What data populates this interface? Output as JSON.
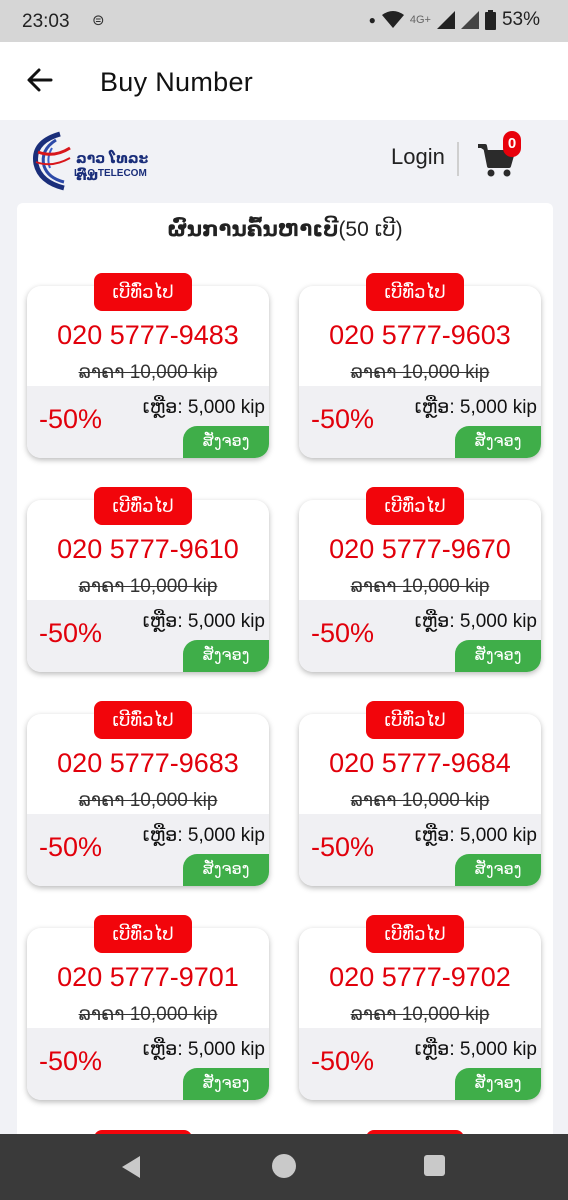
{
  "status_bar": {
    "time": "23:03",
    "network": "4G+",
    "battery": "53%"
  },
  "app_bar": {
    "title": "Buy Number"
  },
  "header": {
    "logo_lao": "ລາວ ໂທລະຄົມ",
    "logo_en": "LAO TELECOM",
    "login_label": "Login",
    "cart_count": "0"
  },
  "results": {
    "title_prefix": "ຜົນການຄົ້ນຫາເບີ",
    "count_text": "(50 ເບີ)"
  },
  "cards": [
    {
      "badge": "ເບີທົ່ວໄປ",
      "number": "020 5777-9483",
      "original_price": "ລາຄາ 10,000 kip",
      "discount": "-50%",
      "remaining": "ເຫຼືອ: 5,000 kip",
      "order_label": "ສັ່ງຈອງ"
    },
    {
      "badge": "ເບີທົ່ວໄປ",
      "number": "020 5777-9603",
      "original_price": "ລາຄາ 10,000 kip",
      "discount": "-50%",
      "remaining": "ເຫຼືອ: 5,000 kip",
      "order_label": "ສັ່ງຈອງ"
    },
    {
      "badge": "ເບີທົ່ວໄປ",
      "number": "020 5777-9610",
      "original_price": "ລາຄາ 10,000 kip",
      "discount": "-50%",
      "remaining": "ເຫຼືອ: 5,000 kip",
      "order_label": "ສັ່ງຈອງ"
    },
    {
      "badge": "ເບີທົ່ວໄປ",
      "number": "020 5777-9670",
      "original_price": "ລາຄາ 10,000 kip",
      "discount": "-50%",
      "remaining": "ເຫຼືອ: 5,000 kip",
      "order_label": "ສັ່ງຈອງ"
    },
    {
      "badge": "ເບີທົ່ວໄປ",
      "number": "020 5777-9683",
      "original_price": "ລາຄາ 10,000 kip",
      "discount": "-50%",
      "remaining": "ເຫຼືອ: 5,000 kip",
      "order_label": "ສັ່ງຈອງ"
    },
    {
      "badge": "ເບີທົ່ວໄປ",
      "number": "020 5777-9684",
      "original_price": "ລາຄາ 10,000 kip",
      "discount": "-50%",
      "remaining": "ເຫຼືອ: 5,000 kip",
      "order_label": "ສັ່ງຈອງ"
    },
    {
      "badge": "ເບີທົ່ວໄປ",
      "number": "020 5777-9701",
      "original_price": "ລາຄາ 10,000 kip",
      "discount": "-50%",
      "remaining": "ເຫຼືອ: 5,000 kip",
      "order_label": "ສັ່ງຈອງ"
    },
    {
      "badge": "ເບີທົ່ວໄປ",
      "number": "020 5777-9702",
      "original_price": "ລາຄາ 10,000 kip",
      "discount": "-50%",
      "remaining": "ເຫຼືອ: 5,000 kip",
      "order_label": "ສັ່ງຈອງ"
    }
  ],
  "colors": {
    "accent_red": "#e1000b",
    "badge_red": "#f2050b",
    "order_green": "#3fae49",
    "logo_blue": "#1a2e7a"
  },
  "icons": {
    "back": "arrow-left-icon",
    "cart": "shopping-cart-icon",
    "nav_back": "triangle-back-icon",
    "nav_home": "circle-home-icon",
    "nav_recent": "square-recents-icon"
  }
}
